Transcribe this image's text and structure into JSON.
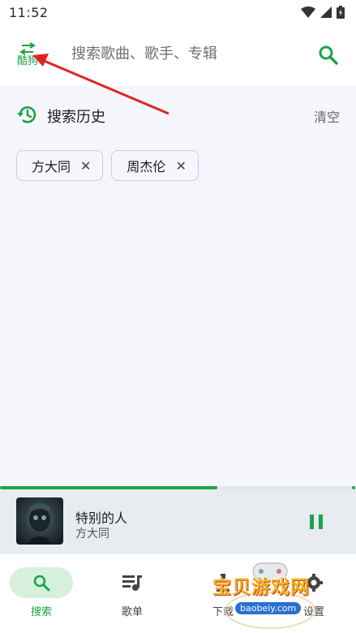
{
  "status_bar": {
    "time": "11:52"
  },
  "search": {
    "source_label": "酷狗",
    "placeholder": "搜索歌曲、歌手、专辑"
  },
  "history": {
    "title": "搜索历史",
    "clear_label": "清空",
    "items": [
      {
        "label": "方大同"
      },
      {
        "label": "周杰伦"
      }
    ]
  },
  "player": {
    "title": "特别的人",
    "artist": "方大同",
    "progress": 0.61
  },
  "nav": {
    "items": [
      {
        "label": "搜索",
        "icon": "search-icon",
        "active": true
      },
      {
        "label": "歌单",
        "icon": "playlist-icon",
        "active": false
      },
      {
        "label": "下载",
        "icon": "download-icon",
        "active": false
      },
      {
        "label": "设置",
        "icon": "settings-icon",
        "active": false
      }
    ]
  },
  "watermark": {
    "text": "宝贝游戏网",
    "url": "baobeiy.com"
  },
  "colors": {
    "accent": "#1da34a",
    "annotation": "#e02424"
  }
}
